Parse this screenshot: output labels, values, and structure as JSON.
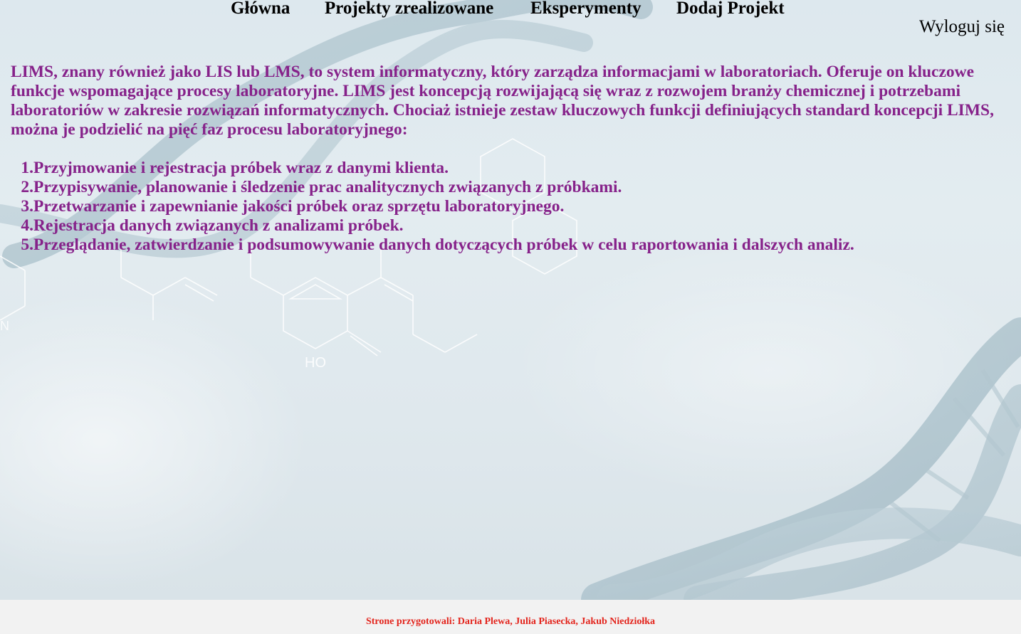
{
  "nav": {
    "items": [
      {
        "label": "Główna"
      },
      {
        "label": "Projekty zrealizowane"
      },
      {
        "label": "Eksperymenty"
      },
      {
        "label": "Dodaj Projekt"
      }
    ],
    "logout_label": "Wyloguj się"
  },
  "content": {
    "intro": "LIMS, znany również jako LIS lub LMS, to system informatyczny, który zarządza informacjami w laboratoriach. Oferuje on kluczowe funkcje wspomagające procesy laboratoryjne. LIMS jest koncepcją rozwijającą się wraz z rozwojem branży chemicznej i potrzebami laboratoriów w zakresie rozwiązań informatycznych. Chociaż istnieje zestaw kluczowych funkcji definiujących standard koncepcji LIMS, można je podzielić na pięć faz procesu laboratoryjnego:",
    "phases": [
      {
        "num": "1.",
        "text": "Przyjmowanie i rejestracja próbek wraz z danymi klienta."
      },
      {
        "num": "2.",
        "text": "Przypisywanie, planowanie i śledzenie prac analitycznych związanych z próbkami."
      },
      {
        "num": "3.",
        "text": "Przetwarzanie i zapewnianie jakości próbek oraz sprzętu laboratoryjnego."
      },
      {
        "num": "4.",
        "text": "Rejestracja danych związanych z analizami próbek."
      },
      {
        "num": "5.",
        "text": "Przeglądanie, zatwierdzanie i podsumowywanie danych dotyczących próbek w celu raportowania i dalszych analiz."
      }
    ]
  },
  "background": {
    "molecule_label": "HO",
    "molecule_label_2": "N"
  },
  "footer": {
    "text": "Strone przygotowali: Daria Plewa, Julia Piasecka, Jakub Niedziołka"
  },
  "colors": {
    "content_text": "#86228a",
    "footer_text": "#e3241c",
    "nav_text": "#000000",
    "footer_bg": "#f2f2f2"
  }
}
